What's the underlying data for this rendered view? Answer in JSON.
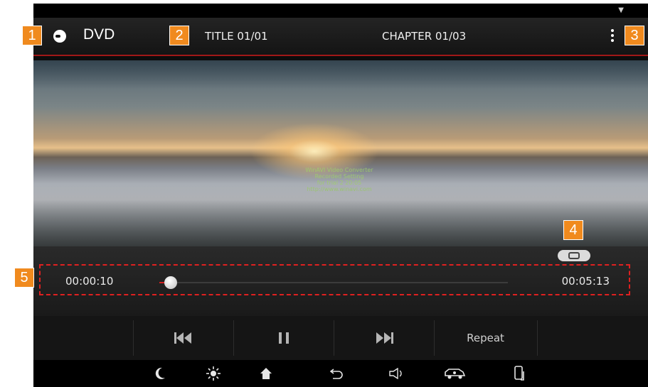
{
  "header": {
    "source_label": "DVD",
    "title_info": "TITLE 01/01",
    "chapter_info": "CHAPTER 01/03"
  },
  "video": {
    "watermark_lines": [
      "WinAVI Video Converter",
      "Recorded Setting",
      "for trial 2 20:05",
      "http://www.winavi.com"
    ]
  },
  "playback": {
    "current_time": "00:00:10",
    "total_time": "00:05:13",
    "progress": 0.032
  },
  "controls": {
    "prev_icon": "skip-previous-icon",
    "pause_icon": "pause-icon",
    "next_icon": "skip-next-icon",
    "repeat_label": "Repeat"
  },
  "navbar": {
    "icons": [
      "moon-icon",
      "brightness-icon",
      "home-icon",
      "back-icon",
      "volume-icon",
      "car-icon",
      "phone-icon"
    ]
  },
  "callouts": [
    "1",
    "2",
    "3",
    "4",
    "5"
  ],
  "colors": {
    "accent": "#d22020",
    "callout": "#f08a1e"
  }
}
